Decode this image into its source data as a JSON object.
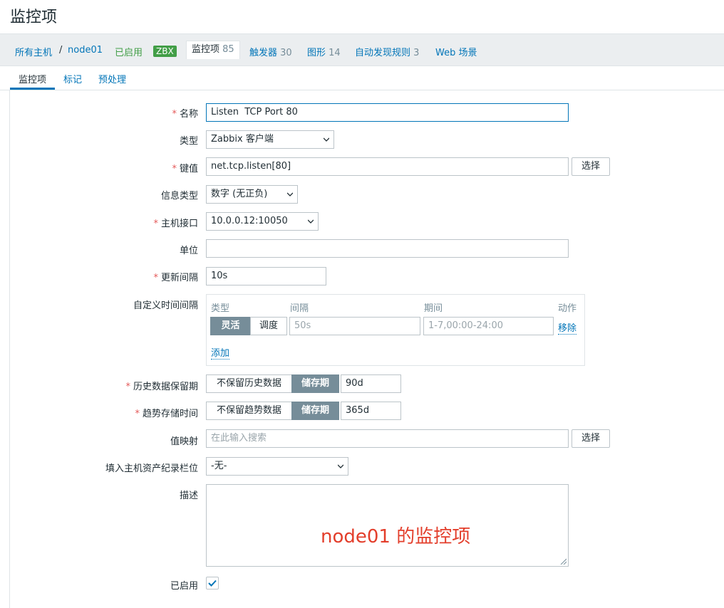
{
  "page": {
    "title": "监控项"
  },
  "breadcrumb": {
    "all_hosts": "所有主机",
    "separator": "/",
    "host": "node01",
    "status": "已启用",
    "zbx": "ZBX",
    "items_label": "监控项",
    "items_count": "85",
    "triggers_label": "触发器",
    "triggers_count": "30",
    "graphs_label": "图形",
    "graphs_count": "14",
    "discovery_label": "自动发现规则",
    "discovery_count": "3",
    "web_label": "Web 场景"
  },
  "tabs": [
    {
      "label": "监控项",
      "active": true
    },
    {
      "label": "标记",
      "active": false
    },
    {
      "label": "预处理",
      "active": false
    }
  ],
  "form": {
    "name": {
      "label": "名称",
      "required": true,
      "value": "Listen  TCP Port 80"
    },
    "type": {
      "label": "类型",
      "value": "Zabbix 客户端"
    },
    "key": {
      "label": "键值",
      "required": true,
      "value": "net.tcp.listen[80]",
      "button": "选择"
    },
    "info_type": {
      "label": "信息类型",
      "value": "数字 (无正负)"
    },
    "interface": {
      "label": "主机接口",
      "required": true,
      "value": "10.0.0.12:10050"
    },
    "units": {
      "label": "单位",
      "value": ""
    },
    "interval": {
      "label": "更新间隔",
      "required": true,
      "value": "10s"
    },
    "custom_intervals": {
      "label": "自定义时间间隔",
      "col_type": "类型",
      "col_interval": "间隔",
      "col_period": "期间",
      "col_action": "动作",
      "seg_flexible": "灵活",
      "seg_scheduling": "调度",
      "interval_placeholder": "50s",
      "period_placeholder": "1-7,00:00-24:00",
      "remove": "移除",
      "add": "添加"
    },
    "history": {
      "label": "历史数据保留期",
      "required": true,
      "seg_off": "不保留历史数据",
      "seg_on": "储存期",
      "value": "90d"
    },
    "trends": {
      "label": "趋势存储时间",
      "required": true,
      "seg_off": "不保留趋势数据",
      "seg_on": "储存期",
      "value": "365d"
    },
    "valuemap": {
      "label": "值映射",
      "placeholder": "在此输入搜索",
      "button": "选择"
    },
    "inventory": {
      "label": "填入主机资产纪录栏位",
      "value": "-无-"
    },
    "description": {
      "label": "描述",
      "value": ""
    },
    "enabled": {
      "label": "已启用",
      "checked": true
    }
  },
  "annotation": "node01 的监控项",
  "colors": {
    "accent": "#0275b8",
    "required": "#e45959",
    "enabled_green": "#429e47",
    "annotation_red": "#e33e2b",
    "segment_active": "#768d99"
  }
}
